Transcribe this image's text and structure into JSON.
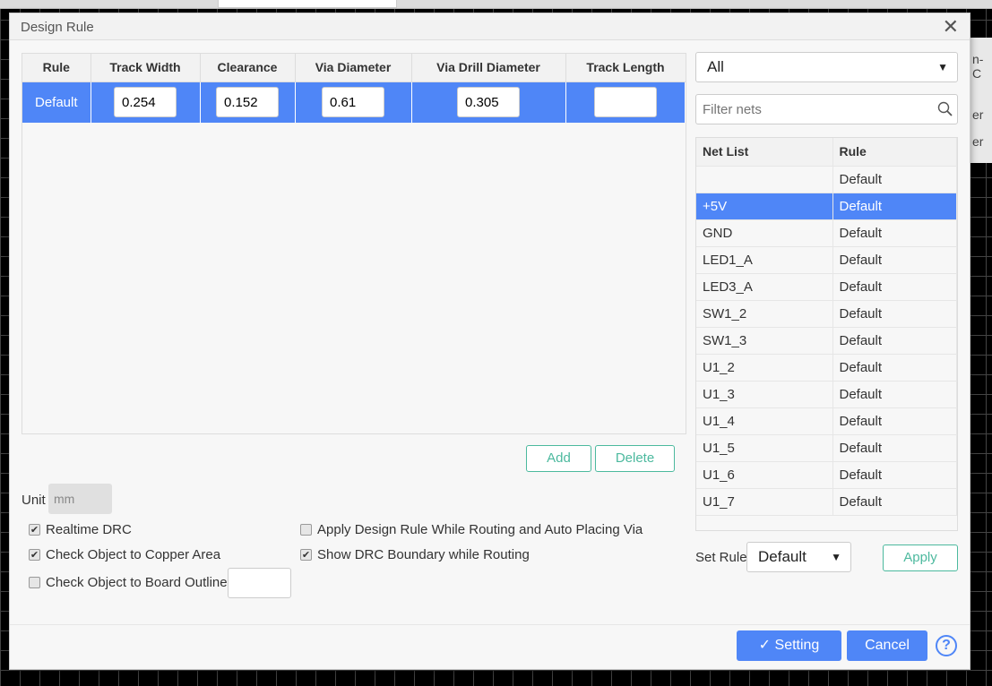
{
  "window": {
    "title": "Design Rule"
  },
  "background_panel": {
    "lines": [
      "n-C",
      "er",
      "er"
    ]
  },
  "rules_table": {
    "columns": [
      "Rule",
      "Track Width",
      "Clearance",
      "Via Diameter",
      "Via Drill Diameter",
      "Track Length"
    ],
    "rows": [
      {
        "rule": "Default",
        "track_width": "0.254",
        "clearance": "0.152",
        "via_diameter": "0.61",
        "via_drill_diameter": "0.305",
        "track_length": "",
        "selected": true
      }
    ]
  },
  "buttons": {
    "add": "Add",
    "delete": "Delete",
    "apply": "Apply",
    "setting": "Setting",
    "cancel": "Cancel",
    "help": "?"
  },
  "unit": {
    "label": "Unit",
    "value": "mm"
  },
  "options": [
    {
      "label": "Realtime DRC",
      "checked": true
    },
    {
      "label": "Check Object to Copper Area",
      "checked": true
    },
    {
      "label": "Check Object to Board Outline",
      "checked": false
    },
    {
      "label": "Apply Design Rule While Routing and Auto Placing Via",
      "checked": false
    },
    {
      "label": "Show DRC Boundary while Routing",
      "checked": true
    }
  ],
  "board_outline_value": "",
  "net_filter": {
    "selected": "All",
    "search_placeholder": "Filter nets"
  },
  "net_table": {
    "columns": [
      "Net List",
      "Rule"
    ],
    "rows": [
      {
        "net": "",
        "rule": "Default"
      },
      {
        "net": "+5V",
        "rule": "Default",
        "selected": true
      },
      {
        "net": "GND",
        "rule": "Default"
      },
      {
        "net": "LED1_A",
        "rule": "Default"
      },
      {
        "net": "LED3_A",
        "rule": "Default"
      },
      {
        "net": "SW1_2",
        "rule": "Default"
      },
      {
        "net": "SW1_3",
        "rule": "Default"
      },
      {
        "net": "U1_2",
        "rule": "Default"
      },
      {
        "net": "U1_3",
        "rule": "Default"
      },
      {
        "net": "U1_4",
        "rule": "Default"
      },
      {
        "net": "U1_5",
        "rule": "Default"
      },
      {
        "net": "U1_6",
        "rule": "Default"
      },
      {
        "net": "U1_7",
        "rule": "Default"
      }
    ]
  },
  "set_rule": {
    "label": "Set Rule",
    "selected": "Default"
  },
  "colors": {
    "accent": "#4f86f7",
    "outline_button": "#4cb99e"
  }
}
